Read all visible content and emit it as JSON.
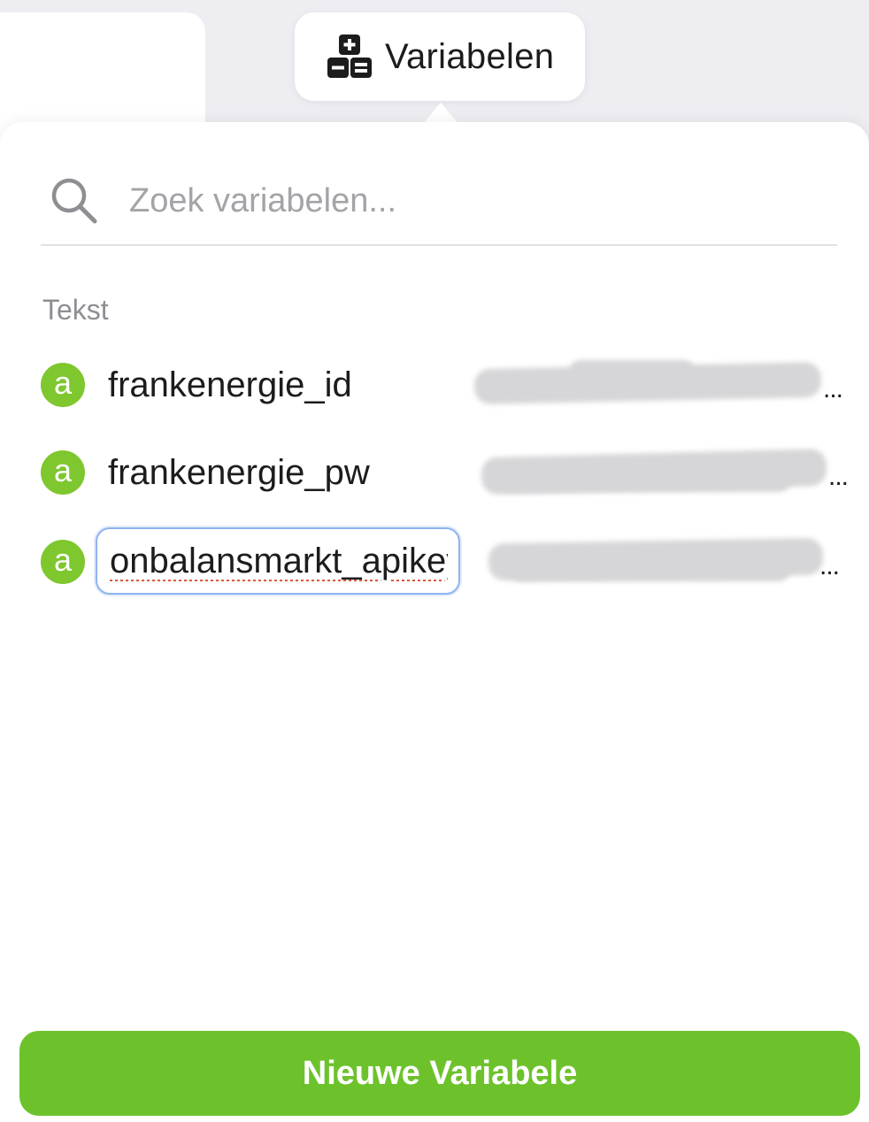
{
  "toolbar": {
    "tab_label": "Variabelen",
    "tab_icon": "calculator-icon"
  },
  "search": {
    "placeholder": "Zoek variabelen...",
    "value": ""
  },
  "sections": [
    {
      "header": "Tekst",
      "items": [
        {
          "type_badge": "a",
          "name": "frankenergie_id",
          "value_redacted": true,
          "editing": false
        },
        {
          "type_badge": "a",
          "name": "frankenergie_pw",
          "value_redacted": true,
          "editing": false
        },
        {
          "type_badge": "a",
          "name": "onbalansmarkt_apikey",
          "value_redacted": true,
          "editing": true
        }
      ]
    }
  ],
  "value_truncation": "...",
  "footer": {
    "new_button_label": "Nieuwe Variabele"
  },
  "colors": {
    "accent_green": "#6dc22c",
    "badge_green": "#7ec72e",
    "focus_blue": "#8fb4ee",
    "spellcheck_red": "#e1553b"
  }
}
